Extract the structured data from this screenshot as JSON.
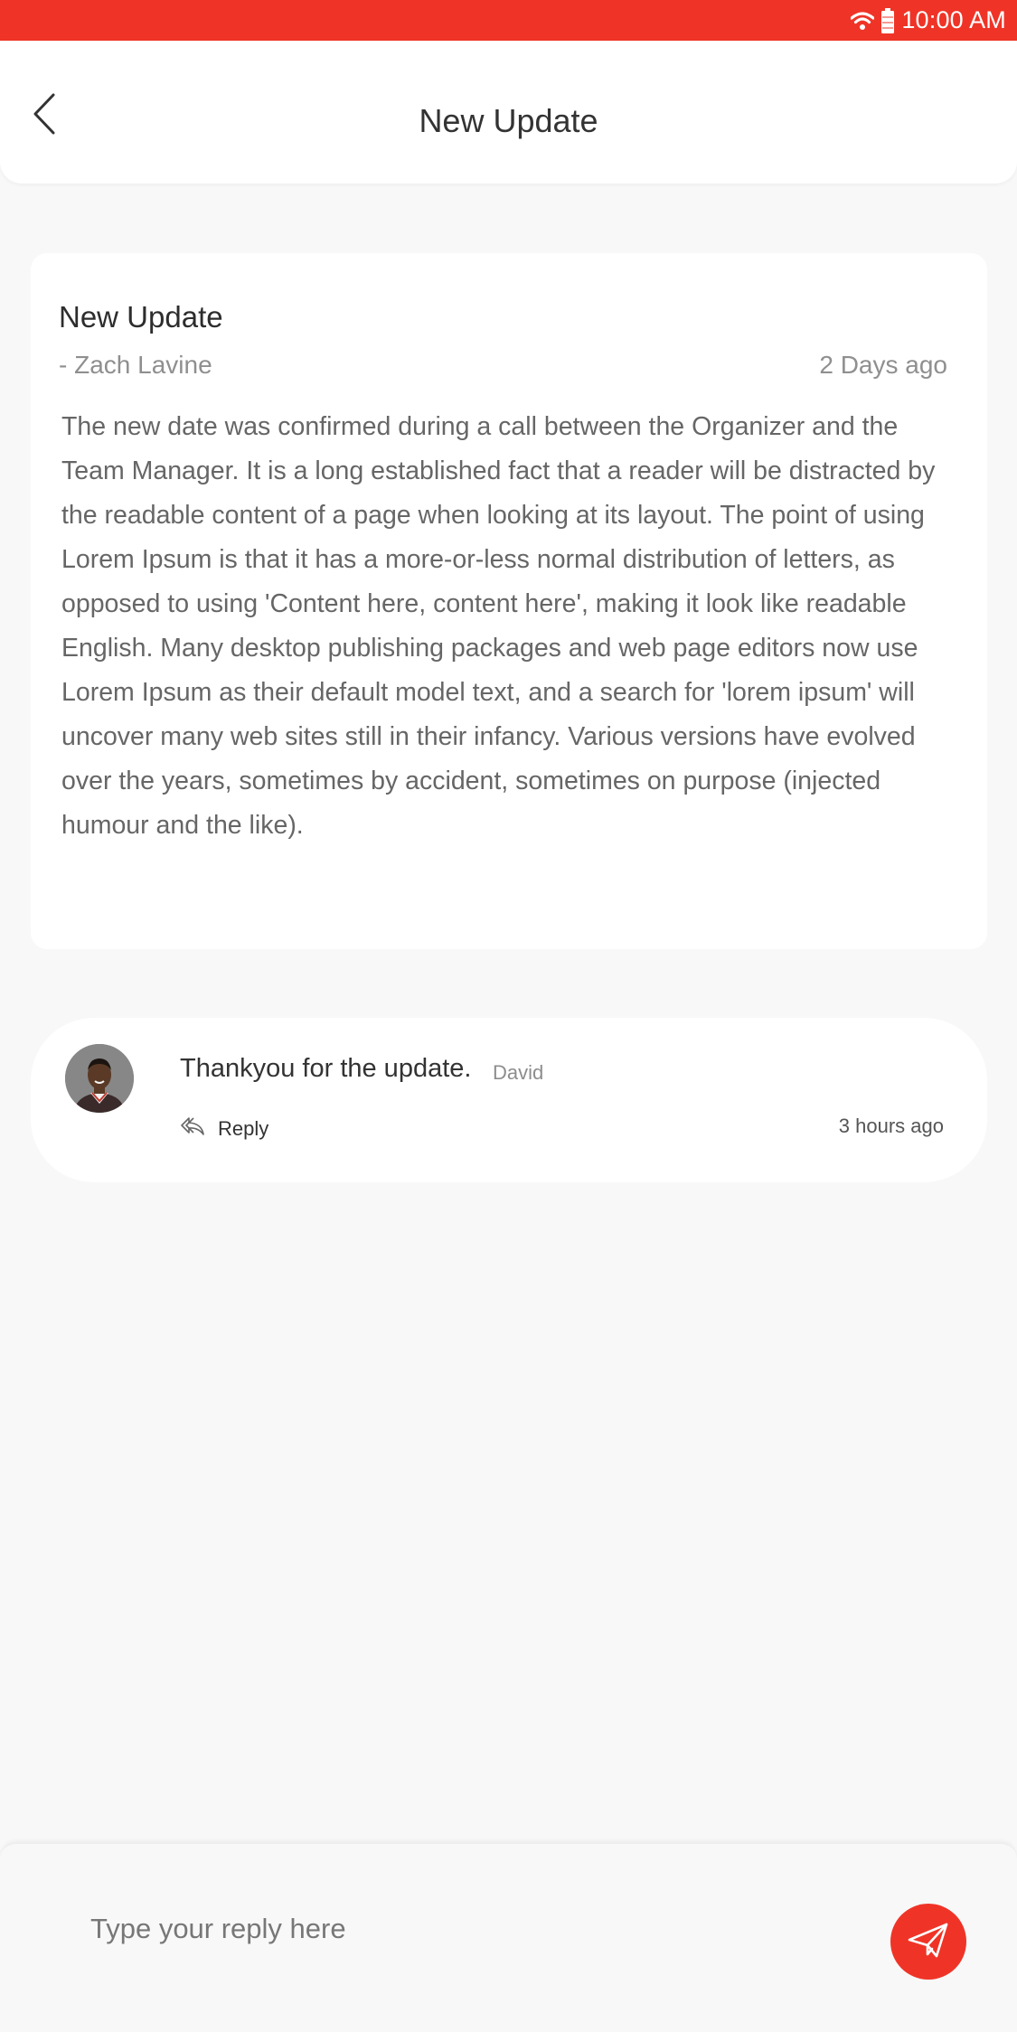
{
  "colors": {
    "accent": "#ef3427",
    "background": "#f8f8f8"
  },
  "status_bar": {
    "time": "10:00 AM",
    "icons": [
      "wifi-icon",
      "battery-icon"
    ]
  },
  "header": {
    "title": "New Update",
    "back_icon": "chevron-left-icon"
  },
  "update": {
    "title": "New Update",
    "author": "- Zach Lavine",
    "time": "2 Days ago",
    "body": "The new date was confirmed during a call between the Organizer  and the Team Manager. It is a long established fact that a reader will be distracted by the readable content of a page when looking at its layout. The point of using Lorem Ipsum is that it has a more-or-less normal distribution of letters, as opposed to using 'Content here, content here', making it look like readable English. Many desktop publishing packages and web page editors now use Lorem Ipsum as their default model text, and a search for 'lorem ipsum' will uncover many web sites still in their infancy. Various versions have evolved over the years, sometimes by accident, sometimes on purpose (injected humour and the like)."
  },
  "comments": [
    {
      "text": "Thankyou for the update.",
      "user": "David",
      "reply_label": "Reply",
      "time": "3 hours ago"
    }
  ],
  "composer": {
    "placeholder": "Type your reply here",
    "send_icon": "paper-plane-icon"
  }
}
